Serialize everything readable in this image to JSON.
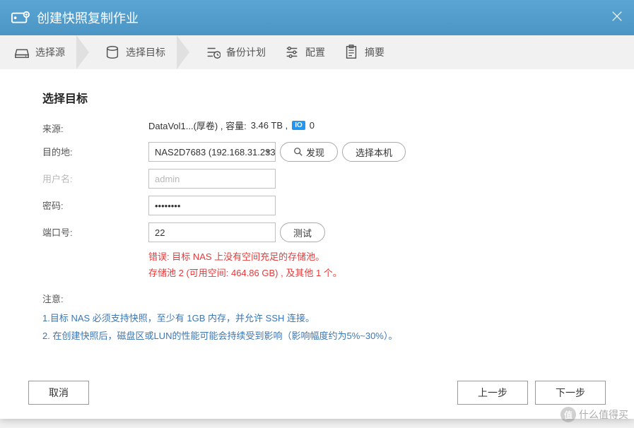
{
  "header": {
    "title": "创建快照复制作业"
  },
  "steps": {
    "s1": "选择源",
    "s2": "选择目标",
    "s3": "备份计划",
    "s4": "配置",
    "s5": "摘要"
  },
  "content": {
    "section_title": "选择目标",
    "source_label": "来源:",
    "source_value_prefix": "DataVol1...(厚卷) , 容量:",
    "source_capacity": "3.46 TB ,",
    "source_io_badge": "IO",
    "source_io_count": "0",
    "destination_label": "目的地:",
    "destination_selected": "NAS2D7683 (192.168.31.233",
    "discover_btn": "发现",
    "local_btn": "选择本机",
    "username_label": "用户名:",
    "username_value": "admin",
    "password_label": "密码:",
    "password_value": "••••••••",
    "port_label": "端口号:",
    "port_value": "22",
    "test_btn": "测试",
    "error_line1": "错误: 目标 NAS 上没有空间充足的存储池。",
    "error_line2": "存储池 2 (可用空间: 464.86 GB) , 及其他 1 个。",
    "notes_label": "注意:",
    "note1": "1.目标 NAS 必须支持快照，至少有 1GB 内存，并允许 SSH 连接。",
    "note2": "2. 在创建快照后，磁盘区或LUN的性能可能会持续受到影响（影响幅度约为5%~30%）。"
  },
  "footer": {
    "cancel": "取消",
    "prev": "上一步",
    "next": "下一步"
  },
  "watermark": {
    "text": "什么值得买"
  }
}
